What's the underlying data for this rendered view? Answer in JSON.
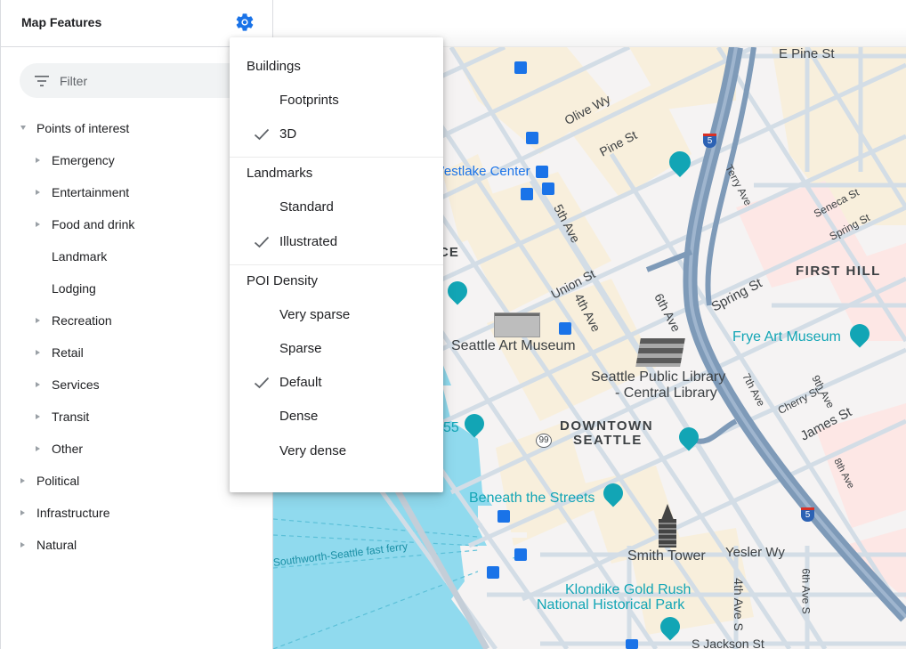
{
  "sidebar": {
    "title": "Map Features",
    "settings_icon": "gear-icon",
    "filter": {
      "placeholder": "Filter",
      "value": "",
      "icon": "filter-list-icon"
    },
    "tree": [
      {
        "label": "Points of interest",
        "level": 0,
        "expander": "expanded"
      },
      {
        "label": "Emergency",
        "level": 1,
        "expander": "collapsed"
      },
      {
        "label": "Entertainment",
        "level": 1,
        "expander": "collapsed"
      },
      {
        "label": "Food and drink",
        "level": 1,
        "expander": "collapsed"
      },
      {
        "label": "Landmark",
        "level": 1,
        "expander": "none"
      },
      {
        "label": "Lodging",
        "level": 1,
        "expander": "none"
      },
      {
        "label": "Recreation",
        "level": 1,
        "expander": "collapsed"
      },
      {
        "label": "Retail",
        "level": 1,
        "expander": "collapsed"
      },
      {
        "label": "Services",
        "level": 1,
        "expander": "collapsed"
      },
      {
        "label": "Transit",
        "level": 1,
        "expander": "collapsed"
      },
      {
        "label": "Other",
        "level": 1,
        "expander": "collapsed"
      },
      {
        "label": "Political",
        "level": 0,
        "expander": "collapsed"
      },
      {
        "label": "Infrastructure",
        "level": 0,
        "expander": "collapsed"
      },
      {
        "label": "Natural",
        "level": 0,
        "expander": "collapsed"
      }
    ]
  },
  "settings_menu": {
    "sections": [
      {
        "title": "Buildings",
        "options": [
          {
            "label": "Footprints",
            "checked": false
          },
          {
            "label": "3D",
            "checked": true
          }
        ]
      },
      {
        "title": "Landmarks",
        "options": [
          {
            "label": "Standard",
            "checked": false
          },
          {
            "label": "Illustrated",
            "checked": true
          }
        ]
      },
      {
        "title": "POI Density",
        "options": [
          {
            "label": "Very sparse",
            "checked": false
          },
          {
            "label": "Sparse",
            "checked": false
          },
          {
            "label": "Default",
            "checked": true
          },
          {
            "label": "Dense",
            "checked": false
          },
          {
            "label": "Very dense",
            "checked": false
          }
        ]
      }
    ]
  },
  "map": {
    "colors": {
      "land": "#f5f3f3",
      "commercial": "#f8efdc",
      "medical": "#fce8e6",
      "water": "#90daee",
      "road": "#d3dde6",
      "highway": "#7e9ab8",
      "poi_teal": "#12a5b5",
      "transit_blue": "#1a73e8",
      "accent": "#1a73e8"
    },
    "labels": {
      "e_pine": "E Pine St",
      "olive": "Olive Wy",
      "pine": "Pine St",
      "westlake": "Westlake Center",
      "fifth": "5th Ave",
      "terry": "Terry Ave",
      "seneca": "Seneca St",
      "spring_top": "Spring St",
      "ce": "CE",
      "union": "Union St",
      "fourth": "4th Ave",
      "sixth": "6th Ave",
      "spring": "Spring St",
      "first_hill": "FIRST HILL",
      "frye": "Frye Art Museum",
      "sam": "Seattle Art Museum",
      "spl1": "Seattle Public Library",
      "spl2": "- Central Library",
      "seventh": "7th Ave",
      "ninth": "9th Ave",
      "cherry": "Cherry St",
      "james": "James St",
      "downtown1": "DOWNTOWN",
      "downtown2": "SEATTLE",
      "pier55": "55",
      "sr99": "99",
      "i5": "5",
      "beneath": "Beneath the Streets",
      "ferry": "Southworth-Seattle fast ferry",
      "smith": "Smith Tower",
      "yesler": "Yesler Wy",
      "fourth_s": "4th Ave S",
      "sixth_s": "6th Ave S",
      "eighth": "8th Ave",
      "klondike1": "Klondike Gold Rush",
      "klondike2": "National Historical Park",
      "jackson": "S Jackson St"
    }
  }
}
